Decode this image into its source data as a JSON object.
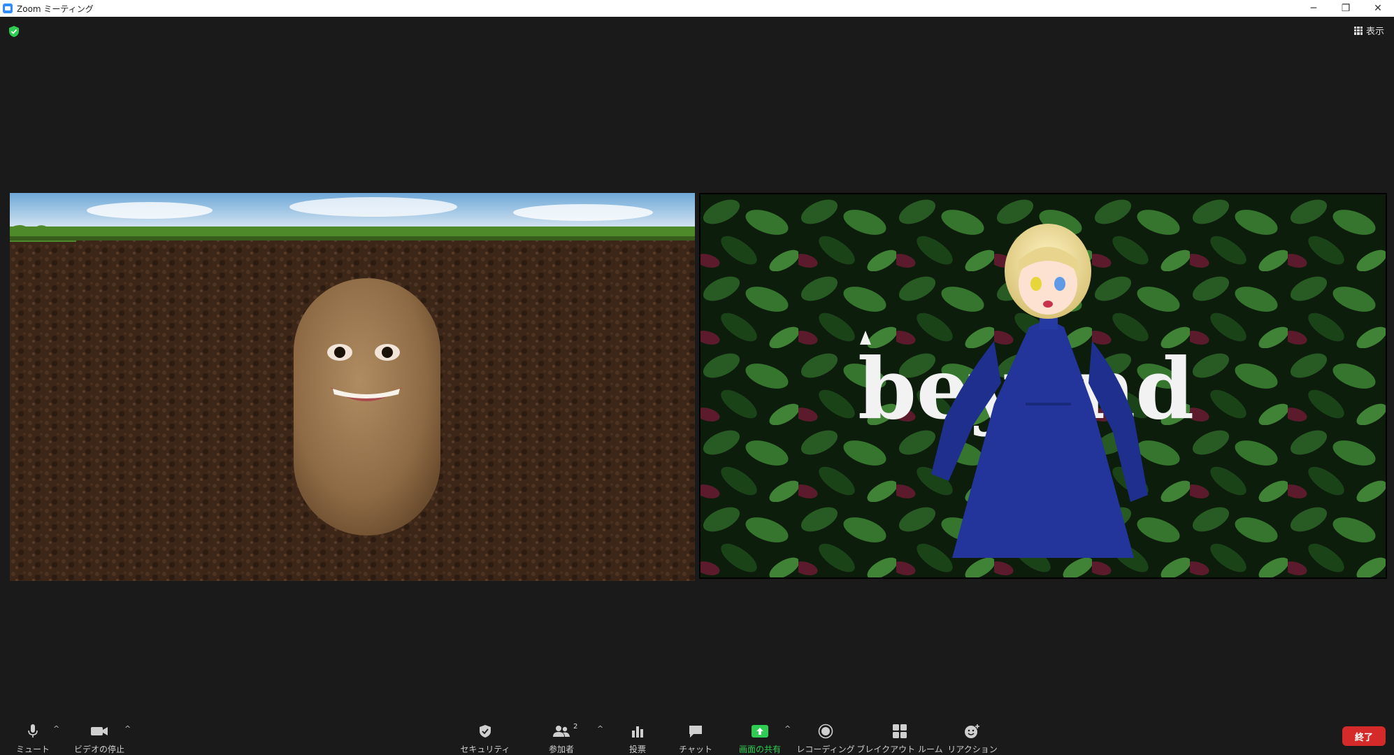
{
  "window": {
    "title": "Zoom ミーティング",
    "minimize": "─",
    "restore": "❐",
    "close": "✕"
  },
  "meeting": {
    "view_label": "表示",
    "right_tile_text": "beyond"
  },
  "toolbar": {
    "mute_label": "ミュート",
    "video_label": "ビデオの停止",
    "security_label": "セキュリティ",
    "participants_label": "参加者",
    "participants_count": "2",
    "polls_label": "投票",
    "chat_label": "チャット",
    "share_label": "画面の共有",
    "record_label": "レコーディング",
    "breakout_label": "ブレイクアウト ルーム",
    "reactions_label": "リアクション",
    "end_label": "終了",
    "caret": "^"
  },
  "colors": {
    "background": "#1a1a1a",
    "share_green": "#2ecc52",
    "end_red": "#d42a2a",
    "zoom_blue": "#2d8cff"
  }
}
